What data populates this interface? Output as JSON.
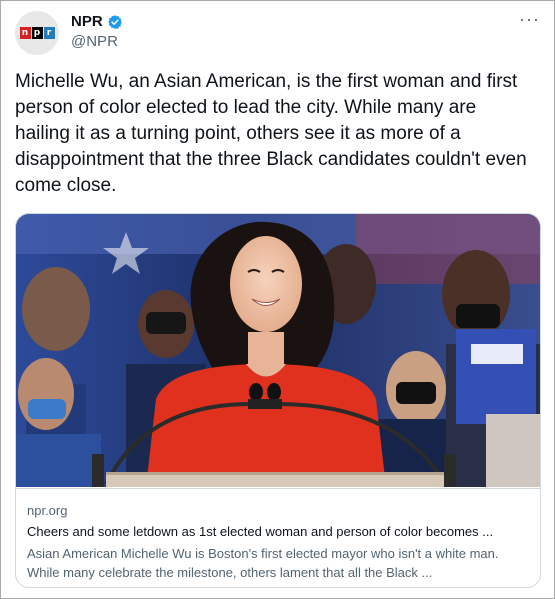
{
  "account": {
    "display_name": "NPR",
    "handle": "@NPR",
    "logo_letters": [
      "n",
      "p",
      "r"
    ],
    "verified": true
  },
  "tweet": {
    "text": "Michelle Wu, an Asian American, is the first woman and first person of color elected to lead the city. While many are hailing it as a turning point, others see it as more of a disappointment that the three Black candidates couldn't even come close.",
    "more_icon": "more-horizontal-icon"
  },
  "link_card": {
    "domain": "npr.org",
    "title": "Cheers and some letdown as 1st elected woman and person of color becomes ...",
    "description": "Asian American Michelle Wu is Boston's first elected mayor who isn't a white man. While many celebrate the milestone, others lament that all the Black ..."
  },
  "colors": {
    "accent_blue": "#1d9bf0",
    "text_primary": "#0f1419",
    "text_secondary": "#536471",
    "npr_red": "#d62021",
    "npr_black": "#000000",
    "npr_blue": "#237bbd",
    "sweater_red": "#e0301e"
  }
}
